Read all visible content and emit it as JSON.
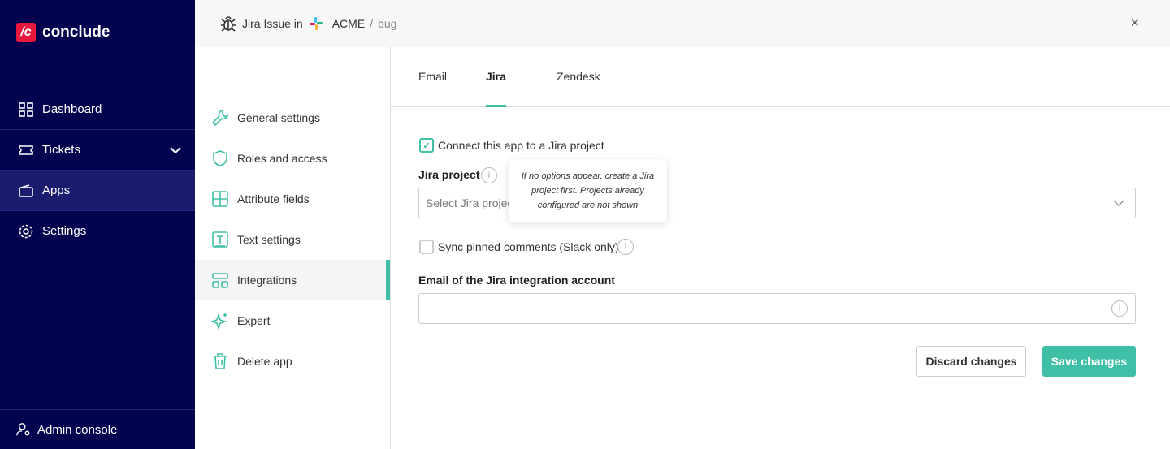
{
  "brand": {
    "logo_mark": "/c",
    "name": "conclude"
  },
  "sidebar": {
    "items": [
      {
        "label": "Dashboard",
        "icon": "grid-icon"
      },
      {
        "label": "Tickets",
        "icon": "ticket-icon"
      },
      {
        "label": "Apps",
        "icon": "apps-icon",
        "active": true
      },
      {
        "label": "Settings",
        "icon": "gear-icon"
      }
    ],
    "admin": "Admin console"
  },
  "header": {
    "prefix": "Jira Issue in",
    "workspace": "ACME",
    "separator": "/",
    "channel": "bug",
    "close": "×"
  },
  "subnav": {
    "items": [
      {
        "label": "General settings"
      },
      {
        "label": "Roles and access"
      },
      {
        "label": "Attribute fields"
      },
      {
        "label": "Text settings"
      },
      {
        "label": "Integrations",
        "active": true
      },
      {
        "label": "Expert"
      },
      {
        "label": "Delete app"
      }
    ]
  },
  "tabs": [
    {
      "label": "Email"
    },
    {
      "label": "Jira",
      "active": true
    },
    {
      "label": "Zendesk"
    }
  ],
  "form": {
    "connect_label": "Connect this app to a Jira project",
    "connect_checked": true,
    "project_label": "Jira project",
    "project_placeholder": "Select Jira project",
    "tooltip": "If no options appear, create a Jira project first. Projects already configured are not shown",
    "sync_label": "Sync pinned comments (Slack only)",
    "sync_checked": false,
    "email_label": "Email of the Jira integration account",
    "email_value": "",
    "discard": "Discard changes",
    "save": "Save changes"
  },
  "colors": {
    "sidebar": "#02024f",
    "accent": "#3fbfa5",
    "logo": "#e8173c"
  }
}
